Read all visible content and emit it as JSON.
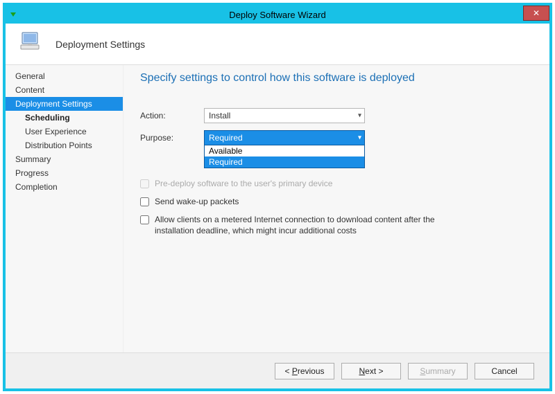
{
  "window": {
    "title": "Deploy Software Wizard",
    "close_label": "✕"
  },
  "header": {
    "title": "Deployment Settings"
  },
  "sidebar": {
    "items": [
      {
        "label": "General",
        "sub": false,
        "active": false
      },
      {
        "label": "Content",
        "sub": false,
        "active": false
      },
      {
        "label": "Deployment Settings",
        "sub": false,
        "active": true
      },
      {
        "label": "Scheduling",
        "sub": true,
        "active": false,
        "bold": true
      },
      {
        "label": "User Experience",
        "sub": true,
        "active": false
      },
      {
        "label": "Distribution Points",
        "sub": true,
        "active": false
      },
      {
        "label": "Summary",
        "sub": false,
        "active": false
      },
      {
        "label": "Progress",
        "sub": false,
        "active": false
      },
      {
        "label": "Completion",
        "sub": false,
        "active": false
      }
    ]
  },
  "main": {
    "heading": "Specify settings to control how this software is deployed",
    "action_label": "Action:",
    "action_value": "Install",
    "purpose_label": "Purpose:",
    "purpose_value": "Required",
    "purpose_options": {
      "opt0": "Available",
      "opt1": "Required"
    },
    "chk_predeploy": "Pre-deploy software to the user's primary device",
    "chk_wakeup": "Send wake-up packets",
    "chk_metered": "Allow clients on a metered Internet connection to download content after the installation deadline, which might incur additional costs"
  },
  "footer": {
    "previous": "< Previous",
    "next": "Next >",
    "summary": "Summary",
    "cancel": "Cancel"
  }
}
